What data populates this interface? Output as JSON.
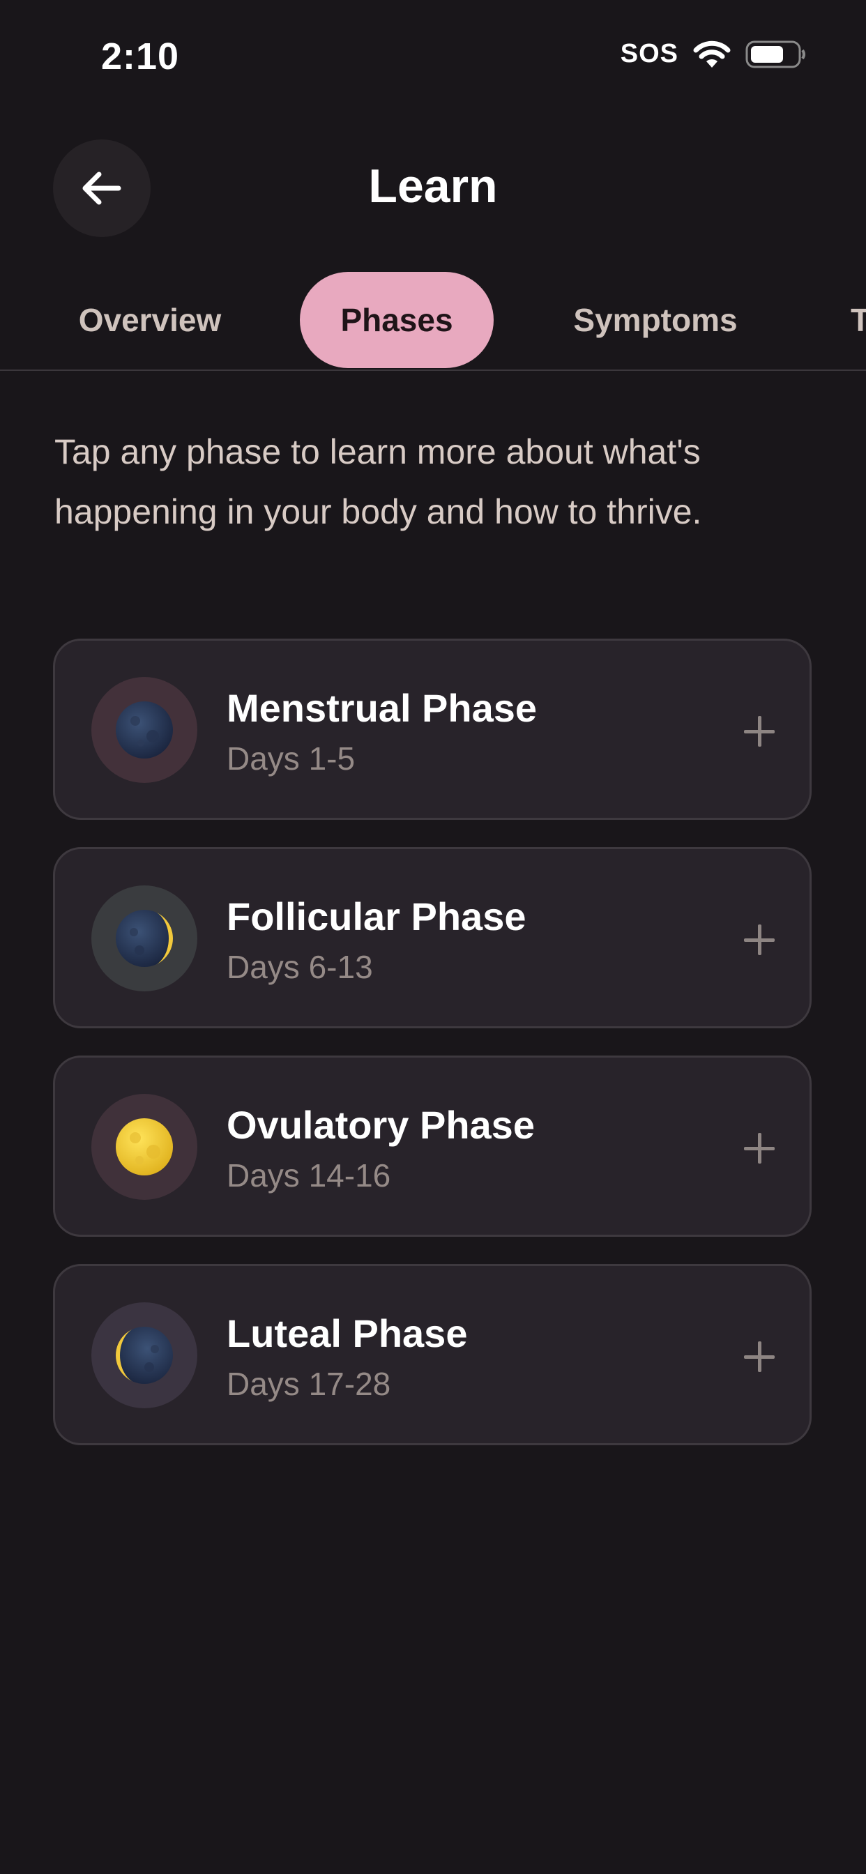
{
  "status_bar": {
    "time": "2:10",
    "sos": "SOS"
  },
  "header": {
    "title": "Learn"
  },
  "tabs": [
    {
      "label": "Overview",
      "active": false
    },
    {
      "label": "Phases",
      "active": true
    },
    {
      "label": "Symptoms",
      "active": false
    },
    {
      "label": "T",
      "active": false
    }
  ],
  "intro": "Tap any phase to learn more about what's happening in your body and how to thrive.",
  "phases": [
    {
      "name": "Menstrual Phase",
      "days": "Days 1-5",
      "icon": "new-moon-icon",
      "icon_bg": "#43313a"
    },
    {
      "name": "Follicular Phase",
      "days": "Days 6-13",
      "icon": "waxing-crescent-moon-icon",
      "icon_bg": "#3a3c3f"
    },
    {
      "name": "Ovulatory Phase",
      "days": "Days 14-16",
      "icon": "full-moon-icon",
      "icon_bg": "#40313a"
    },
    {
      "name": "Luteal Phase",
      "days": "Days 17-28",
      "icon": "waning-crescent-moon-icon",
      "icon_bg": "#3b3441"
    }
  ],
  "colors": {
    "background": "#19161a",
    "card": "#28232a",
    "accent_pink": "#e8a9bf"
  }
}
